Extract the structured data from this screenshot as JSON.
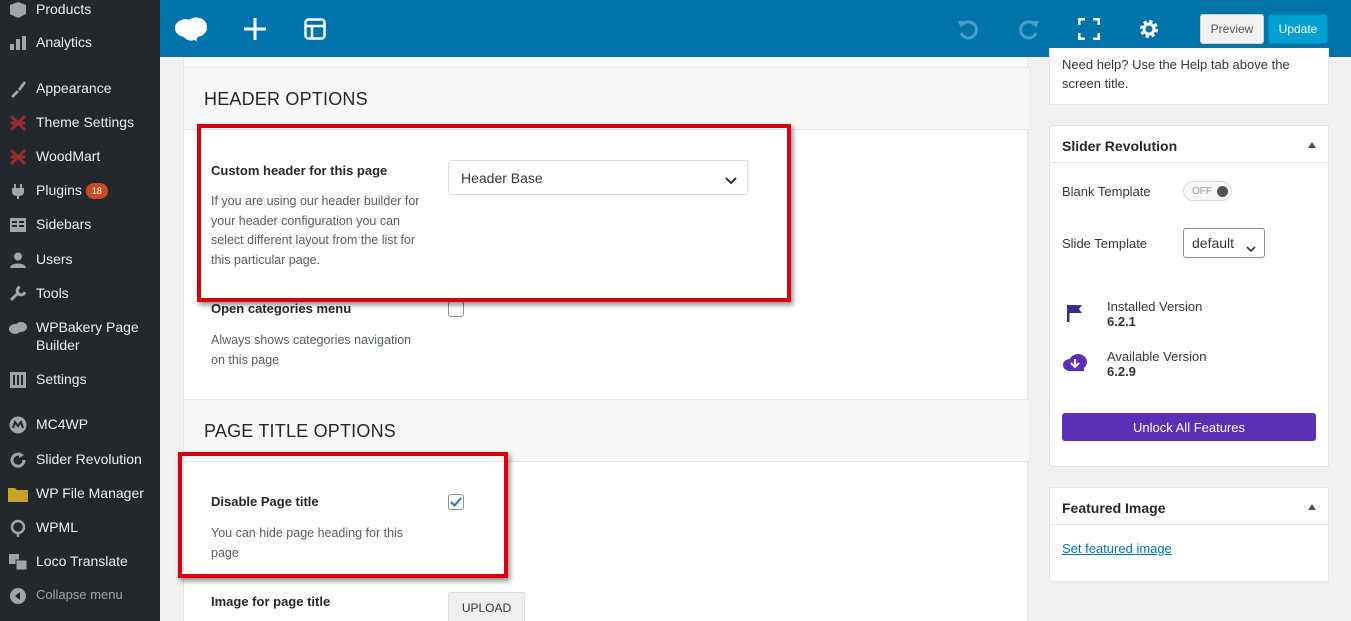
{
  "sidebar": {
    "items": [
      {
        "label": "Products",
        "icon": "products-icon"
      },
      {
        "label": "Analytics",
        "icon": "analytics-icon"
      },
      {
        "label": "Appearance",
        "icon": "appearance-icon"
      },
      {
        "label": "Theme Settings",
        "icon": "theme-settings-icon"
      },
      {
        "label": "WoodMart",
        "icon": "woodmart-icon"
      },
      {
        "label": "Plugins",
        "icon": "plugins-icon",
        "badge": "18"
      },
      {
        "label": "Sidebars",
        "icon": "sidebars-icon"
      },
      {
        "label": "Users",
        "icon": "users-icon"
      },
      {
        "label": "Tools",
        "icon": "tools-icon"
      },
      {
        "label": "WPBakery Page Builder",
        "icon": "wpbakery-icon"
      },
      {
        "label": "Settings",
        "icon": "settings-icon"
      },
      {
        "label": "MC4WP",
        "icon": "mc4wp-icon"
      },
      {
        "label": "Slider Revolution",
        "icon": "slider-revolution-icon"
      },
      {
        "label": "WP File Manager",
        "icon": "folder-icon"
      },
      {
        "label": "WPML",
        "icon": "wpml-icon"
      },
      {
        "label": "Loco Translate",
        "icon": "translate-icon"
      },
      {
        "label": "Collapse menu",
        "icon": "collapse-icon"
      }
    ]
  },
  "toolbar": {
    "preview_label": "Preview",
    "update_label": "Update",
    "icons": [
      "logo-icon",
      "add-icon",
      "layout-icon",
      "undo-icon",
      "redo-icon",
      "fullscreen-icon",
      "gear-icon"
    ]
  },
  "main": {
    "header_section": {
      "title": "HEADER OPTIONS",
      "custom_header_label": "Custom header for this page",
      "custom_header_desc": "If you are using our header builder for your header configuration you can select different layout from the list for this particular page.",
      "custom_header_value": "Header Base",
      "open_categories_label": "Open categories menu",
      "open_categories_desc": "Always shows categories navigation on this page",
      "open_categories_checked": false
    },
    "page_title_section": {
      "title": "PAGE TITLE OPTIONS",
      "disable_title_label": "Disable Page title",
      "disable_title_desc": "You can hide page heading for this page",
      "disable_title_checked": true,
      "image_label": "Image for page title",
      "upload_label": "UPLOAD"
    }
  },
  "right": {
    "help_text": "Need help? Use the Help tab above the screen title.",
    "slider_revolution": {
      "title": "Slider Revolution",
      "blank_template_label": "Blank Template",
      "blank_template_toggle": "OFF",
      "slide_template_label": "Slide Template",
      "slide_template_value": "default",
      "installed_label": "Installed Version",
      "installed_value": "6.2.1",
      "available_label": "Available Version",
      "available_value": "6.2.9",
      "unlock_label": "Unlock All Features"
    },
    "featured_image": {
      "title": "Featured Image",
      "link_label": "Set featured image"
    }
  },
  "colors": {
    "topbar": "#0073aa",
    "sidebar": "#23282d",
    "highlight": "#d9000d",
    "unlock": "#5a2fb5",
    "update": "#00a0d2"
  }
}
